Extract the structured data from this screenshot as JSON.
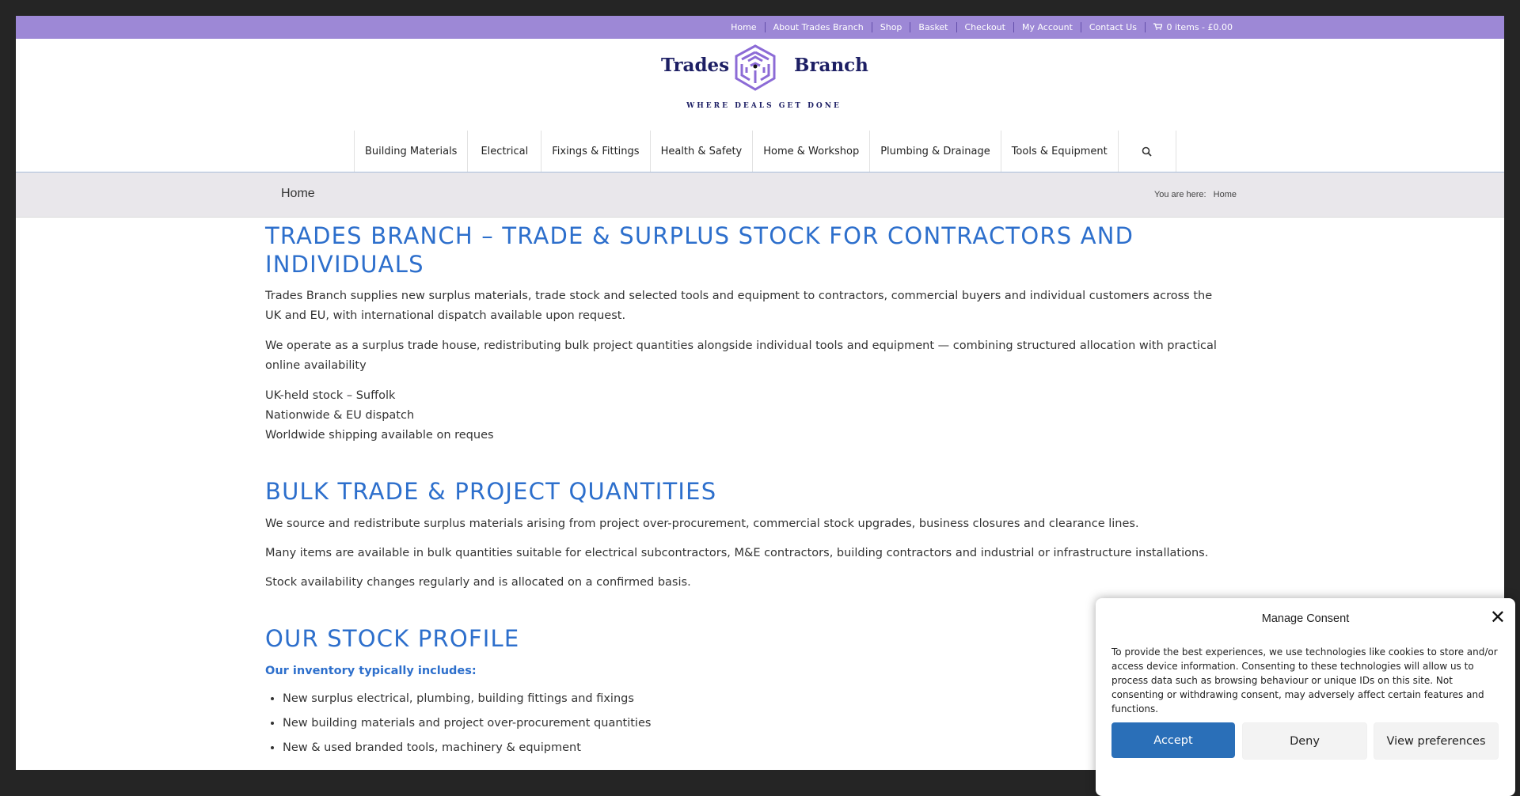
{
  "topbar": {
    "links": [
      "Home",
      "About Trades Branch",
      "Shop",
      "Basket",
      "Checkout",
      "My Account",
      "Contact Us"
    ],
    "cart": "0 items - £0.00",
    "cart_icon": "cart-icon"
  },
  "logo": {
    "left_word": "Trades",
    "right_word": "Branch",
    "tagline": "WHERE DEALS GET DONE",
    "icon": "cube-maze-icon"
  },
  "nav": {
    "items": [
      "Building Materials",
      "Electrical",
      "Fixings & Fittings",
      "Health & Safety",
      "Home & Workshop",
      "Plumbing & Drainage",
      "Tools & Equipment"
    ],
    "search_icon": "search-icon"
  },
  "titlebar": {
    "title": "Home",
    "breadcrumb_prefix": "You are here:",
    "breadcrumb_current": "Home"
  },
  "content": {
    "h1": "TRADES BRANCH – TRADE & SURPLUS STOCK FOR CONTRACTORS AND INDIVIDUALS",
    "p1": "Trades Branch supplies new surplus materials, trade stock and selected tools and equipment to contractors, commercial buyers and individual customers across the UK and EU, with international dispatch available upon request.",
    "p2": "We operate as a surplus trade house, redistributing bulk project quantities alongside individual tools and equipment — combining structured allocation with practical online availability",
    "lines": [
      "UK-held stock – Suffolk",
      "Nationwide & EU dispatch",
      "Worldwide shipping available on reques"
    ],
    "h2": "BULK TRADE & PROJECT QUANTITIES",
    "p3": "We source and redistribute surplus materials arising from project over-procurement, commercial stock upgrades, business closures and clearance lines.",
    "p4": "Many items are available in bulk quantities suitable for electrical subcontractors, M&E contractors, building contractors and industrial or infrastructure installations.",
    "p5": "Stock availability changes regularly and is allocated on a confirmed basis.",
    "h3": "OUR STOCK PROFILE",
    "lead": "Our inventory typically includes:",
    "bullets": [
      "New surplus electrical, plumbing, building fittings and fixings",
      "New building materials and project over-procurement quantities",
      "New & used branded tools, machinery & equipment"
    ]
  },
  "consent": {
    "title": "Manage Consent",
    "close_icon": "close-icon",
    "text": "To provide the best experiences, we use technologies like cookies to store and/or access device information. Consenting to these technologies will allow us to process data such as browsing behaviour or unique IDs on this site. Not consenting or withdrawing consent, may adversely affect certain features and functions.",
    "accept": "Accept",
    "deny": "Deny",
    "preferences": "View preferences"
  }
}
